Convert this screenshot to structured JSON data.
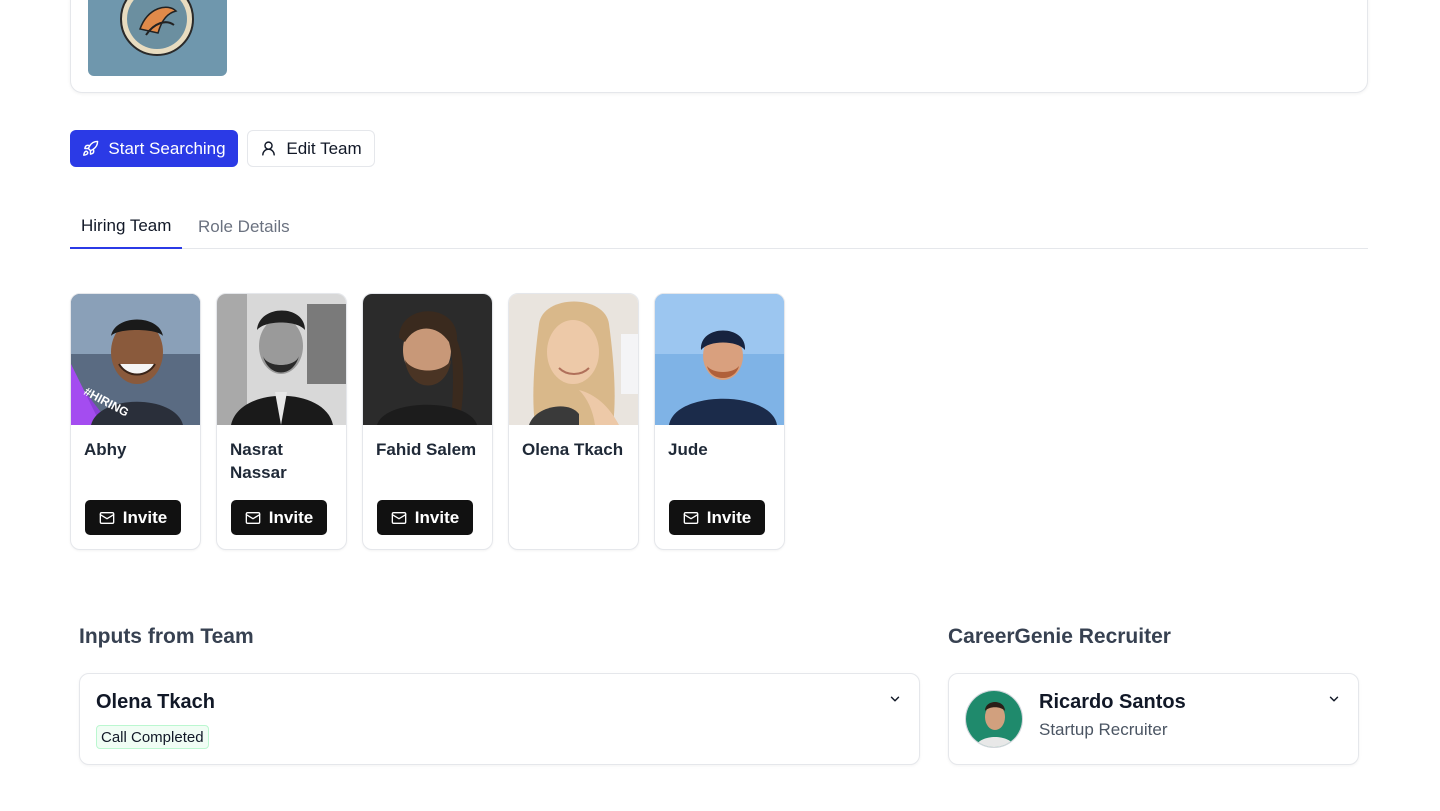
{
  "actions": {
    "start_searching": "Start Searching",
    "edit_team": "Edit Team"
  },
  "tabs": [
    {
      "label": "Hiring Team",
      "active": true
    },
    {
      "label": "Role Details",
      "active": false
    }
  ],
  "team": [
    {
      "name": "Abhy",
      "invite_label": "Invite",
      "photo_badge": "#HIRING"
    },
    {
      "name": "Nasrat Nassar",
      "invite_label": "Invite"
    },
    {
      "name": "Fahid Salem",
      "invite_label": "Invite"
    },
    {
      "name": "Olena Tkach"
    },
    {
      "name": "Jude",
      "invite_label": "Invite"
    }
  ],
  "inputs_section": {
    "title": "Inputs from Team",
    "entries": [
      {
        "name": "Olena Tkach",
        "status": "Call Completed"
      }
    ]
  },
  "recruiter_section": {
    "title": "CareerGenie Recruiter",
    "name": "Ricardo Santos",
    "role": "Startup Recruiter"
  },
  "colors": {
    "primary": "#2b3ae6",
    "invite_button": "#111111",
    "status_badge_bg": "#f0fdf4",
    "active_tab": "#2b3ae6"
  }
}
